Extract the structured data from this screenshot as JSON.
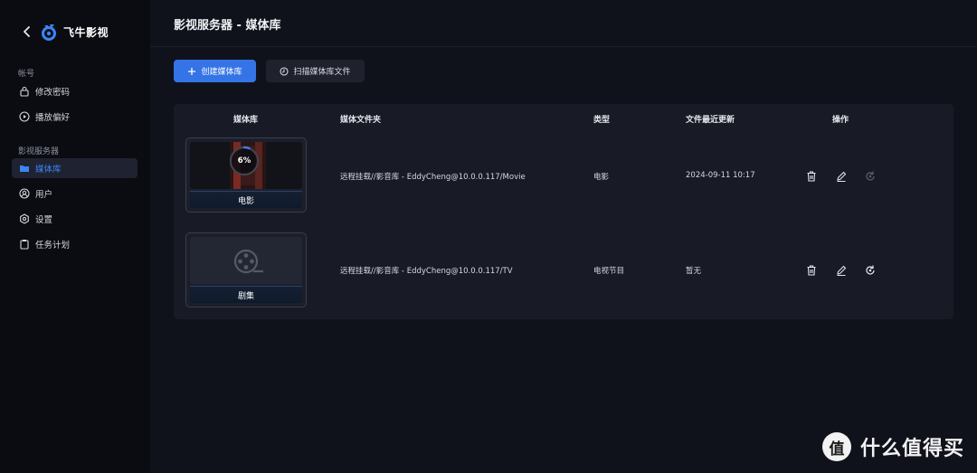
{
  "app": {
    "name": "飞牛影视"
  },
  "sidebar": {
    "sections": [
      {
        "title": "帐号",
        "items": [
          {
            "label": "修改密码",
            "icon": "lock-icon"
          },
          {
            "label": "播放偏好",
            "icon": "play-circle-icon"
          }
        ]
      },
      {
        "title": "影视服务器",
        "items": [
          {
            "label": "媒体库",
            "icon": "folder-icon",
            "active": true
          },
          {
            "label": "用户",
            "icon": "user-icon"
          },
          {
            "label": "设置",
            "icon": "gear-icon"
          },
          {
            "label": "任务计划",
            "icon": "clipboard-icon"
          }
        ]
      }
    ]
  },
  "header": {
    "title": "影视服务器 - 媒体库"
  },
  "toolbar": {
    "create_label": "创建媒体库",
    "scan_label": "扫描媒体库文件"
  },
  "table": {
    "columns": [
      "媒体库",
      "媒体文件夹",
      "类型",
      "文件最近更新",
      "操作"
    ],
    "rows": [
      {
        "name": "电影",
        "progress_text": "6%",
        "progress": 0.06,
        "folder": "远程挂载//影音库 - EddyCheng@10.0.0.117/Movie",
        "type": "电影",
        "updated": "2024-09-11 10:17",
        "refresh_enabled": false
      },
      {
        "name": "剧集",
        "folder": "远程挂载//影音库 - EddyCheng@10.0.0.117/TV",
        "type": "电视节目",
        "updated": "暂无",
        "refresh_enabled": true
      }
    ]
  },
  "colors": {
    "accent": "#3574e6",
    "active_text": "#3a86f5",
    "background": "#10121b",
    "panel": "#181b26"
  },
  "watermark": {
    "text": "什么值得买",
    "badge": "值"
  }
}
